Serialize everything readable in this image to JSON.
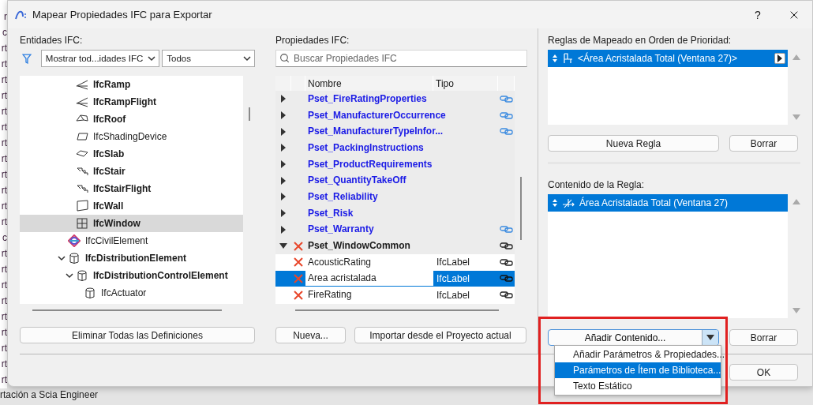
{
  "window": {
    "title": "Mapear Propiedades IFC para Exportar",
    "help": "?"
  },
  "background": {
    "edge_texts": [
      "r",
      "c",
      "rt",
      "rt",
      "rt",
      "rt",
      "rt",
      "rt",
      "rt",
      "rt",
      "rt",
      "rt",
      "rt",
      "rt",
      "c",
      "rt",
      "rt",
      "rt",
      "rt",
      "rt",
      "rt",
      "rt",
      "rt",
      "rt"
    ],
    "bottom_text": "rtación a Scia Engineer"
  },
  "entities": {
    "label": "Entidades IFC:",
    "filter": "Mostrar tod...idades IFC",
    "scope": "Todos",
    "tree": {
      "partial_branch": [
        {
          "label": "IfcRamp",
          "kind": "ramp",
          "bold": true,
          "selected": false
        },
        {
          "label": "IfcRampFlight",
          "kind": "ramp",
          "bold": true,
          "selected": false
        },
        {
          "label": "IfcRoof",
          "kind": "roof",
          "bold": true,
          "selected": false
        },
        {
          "label": "IfcShadingDevice",
          "kind": "shading",
          "bold": false,
          "selected": false
        },
        {
          "label": "IfcSlab",
          "kind": "slab",
          "bold": true,
          "selected": false
        },
        {
          "label": "IfcStair",
          "kind": "stair",
          "bold": true,
          "selected": false
        },
        {
          "label": "IfcStairFlight",
          "kind": "stair",
          "bold": true,
          "selected": false
        },
        {
          "label": "IfcWall",
          "kind": "wall",
          "bold": true,
          "selected": false
        },
        {
          "label": "IfcWindow",
          "kind": "window",
          "bold": true,
          "selected": true
        }
      ],
      "items": [
        {
          "label": "IfcCivilElement",
          "kind": "civil",
          "bold": false,
          "selected": false
        },
        {
          "label": "IfcDistributionElement",
          "kind": "distribution",
          "bold": true,
          "selected": false,
          "expanded": true,
          "children": [
            {
              "label": "IfcDistributionControlElement",
              "kind": "distribution",
              "bold": true,
              "selected": false,
              "expanded": true,
              "children": [
                {
                  "label": "IfcActuator",
                  "kind": "distribution",
                  "bold": false,
                  "selected": false
                }
              ]
            }
          ]
        }
      ]
    },
    "delete_button": "Eliminar Todas las Definiciones"
  },
  "properties": {
    "label": "Propiedades IFC:",
    "search": {
      "placeholder": "Buscar Propiedades IFC"
    },
    "columns": [
      "Nombre",
      "Tipo"
    ],
    "rows": [
      {
        "kind": "pset",
        "name": "Pset_FireRatingProperties",
        "expanded": false,
        "mapped": false,
        "linked": true,
        "selected": false
      },
      {
        "kind": "pset",
        "name": "Pset_ManufacturerOccurrence",
        "expanded": false,
        "mapped": false,
        "linked": true,
        "selected": false
      },
      {
        "kind": "pset",
        "name": "Pset_ManufacturerTypeInfor...",
        "expanded": false,
        "mapped": false,
        "linked": true,
        "selected": false
      },
      {
        "kind": "pset",
        "name": "Pset_PackingInstructions",
        "expanded": false,
        "mapped": false,
        "linked": false,
        "selected": false
      },
      {
        "kind": "pset",
        "name": "Pset_ProductRequirements",
        "expanded": false,
        "mapped": false,
        "linked": false,
        "selected": false
      },
      {
        "kind": "pset",
        "name": "Pset_QuantityTakeOff",
        "expanded": false,
        "mapped": false,
        "linked": false,
        "selected": false
      },
      {
        "kind": "pset",
        "name": "Pset_Reliability",
        "expanded": false,
        "mapped": false,
        "linked": false,
        "selected": false
      },
      {
        "kind": "pset",
        "name": "Pset_Risk",
        "expanded": false,
        "mapped": false,
        "linked": false,
        "selected": false
      },
      {
        "kind": "pset",
        "name": "Pset_Warranty",
        "expanded": false,
        "mapped": false,
        "linked": true,
        "selected": false
      },
      {
        "kind": "pset",
        "name": "Pset_WindowCommon",
        "expanded": true,
        "mapped": true,
        "linked": true,
        "selected": false
      },
      {
        "kind": "property",
        "name": "AcousticRating",
        "type": "IfcLabel",
        "mapped": true,
        "linked": true,
        "selected": false
      },
      {
        "kind": "property",
        "name": "Area acristalada",
        "type": "IfcLabel",
        "mapped": true,
        "linked": true,
        "selected": true
      },
      {
        "kind": "property",
        "name": "FireRating",
        "type": "IfcLabel",
        "mapped": true,
        "linked": true,
        "selected": false
      }
    ],
    "buttons": [
      "Nueva...",
      "Importar desde el Proyecto actual"
    ]
  },
  "rules": {
    "label": "Reglas de Mapeado en Orden de Prioridad:",
    "items": [
      {
        "text": "<Área Acristalada Total (Ventana 27)>",
        "selected": true
      }
    ],
    "buttons": [
      "Nueva Regla",
      "Borrar"
    ]
  },
  "content": {
    "label": "Contenido de la Regla:",
    "items": [
      {
        "text": "Área Acristalada Total (Ventana 27)",
        "selected": true
      }
    ],
    "add_button": "Añadir Contenido...",
    "delete_button": "Borrar",
    "menu": [
      {
        "label": "Añadir Parámetros & Propiedades...",
        "selected": false
      },
      {
        "label": "Parámetros de Ítem de Biblioteca...",
        "selected": true
      },
      {
        "label": "Texto Estático",
        "selected": false
      }
    ]
  },
  "ok_button": "OK"
}
